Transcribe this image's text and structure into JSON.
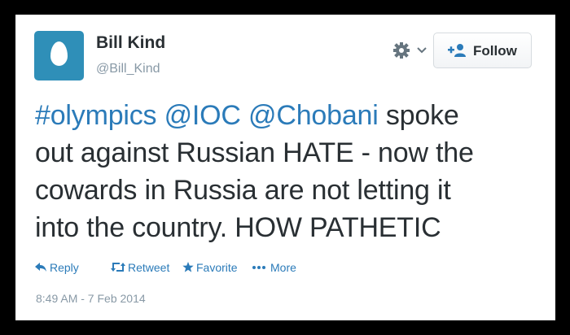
{
  "author": {
    "name": "Bill Kind",
    "handle": "@Bill_Kind",
    "avatar_icon": "egg-avatar-icon"
  },
  "header": {
    "settings_icon": "gear-icon",
    "follow_label": "Follow"
  },
  "tweet": {
    "hashtag": "#olympics",
    "mention_1": "@IOC",
    "mention_2": "@Chobani",
    "text_line_1_rest": "spoke",
    "text_line_2": "out against Russian HATE - now the",
    "text_line_3": "cowards in Russia are not letting it",
    "text_line_4": "into the country. HOW PATHETIC"
  },
  "actions": {
    "reply": "Reply",
    "retweet": "Retweet",
    "favorite": "Favorite",
    "more": "More"
  },
  "timestamp": "8:49 AM - 7 Feb 2014",
  "colors": {
    "link": "#2b7bb9",
    "text": "#292f33",
    "muted": "#8899a6",
    "avatar_bg": "#2f8fb8",
    "background": "#000000"
  }
}
